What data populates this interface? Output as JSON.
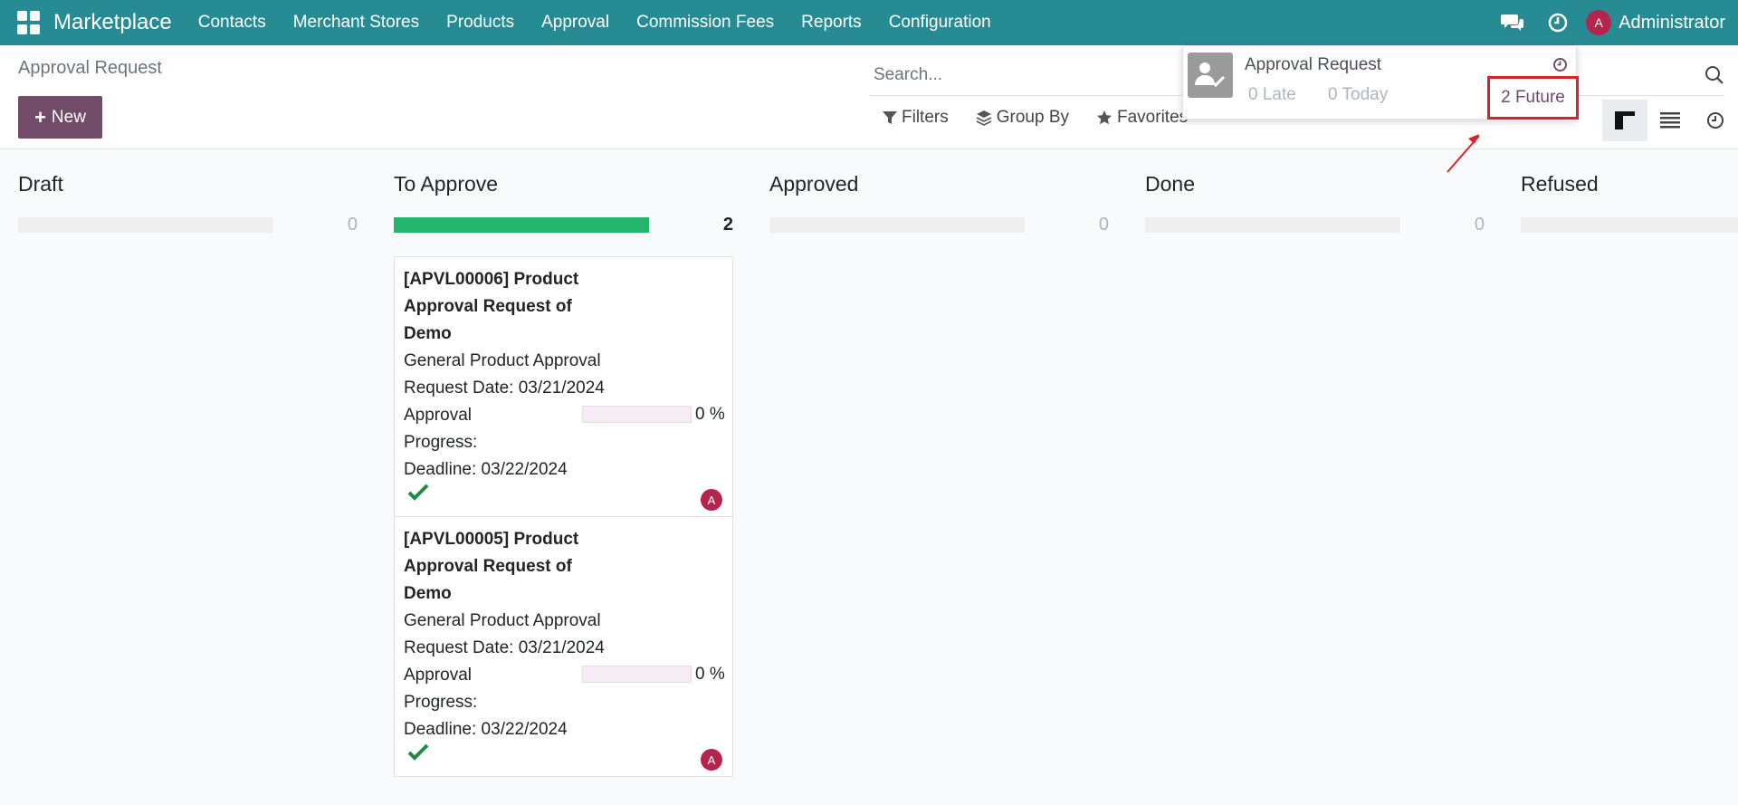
{
  "navbar": {
    "brand": "Marketplace",
    "menu": [
      "Contacts",
      "Merchant Stores",
      "Products",
      "Approval",
      "Commission Fees",
      "Reports",
      "Configuration"
    ],
    "user_initial": "A",
    "user_name": "Administrator"
  },
  "control_panel": {
    "breadcrumb": "Approval Request",
    "new_label": "New",
    "search_placeholder": "Search...",
    "filters_label": "Filters",
    "group_by_label": "Group By",
    "favorites_label": "Favorites"
  },
  "activity_popover": {
    "title": "Approval Request",
    "late": "0 Late",
    "today": "0 Today",
    "future": "2 Future"
  },
  "kanban": {
    "columns": [
      {
        "title": "Draft",
        "count": "0",
        "progress": 0
      },
      {
        "title": "To Approve",
        "count": "2",
        "progress": 1
      },
      {
        "title": "Approved",
        "count": "0",
        "progress": 0
      },
      {
        "title": "Done",
        "count": "0",
        "progress": 0
      },
      {
        "title": "Refused",
        "count": "",
        "progress": 0
      }
    ],
    "cards": [
      {
        "title": "[APVL00006] Product Approval Request of Demo",
        "title_lines": [
          "[APVL00006] Product",
          "Approval Request of",
          "Demo"
        ],
        "type": "General Product Approval",
        "request_date": "Request Date: 03/21/2024",
        "progress_label_1": "Approval",
        "progress_label_2": "Progress:",
        "progress_value": "0 %",
        "deadline": "Deadline: 03/22/2024",
        "avatar": "A"
      },
      {
        "title": "[APVL00005] Product Approval Request of Demo",
        "title_lines": [
          "[APVL00005] Product",
          "Approval Request of",
          "Demo"
        ],
        "type": "General Product Approval",
        "request_date": "Request Date: 03/21/2024",
        "progress_label_1": "Approval",
        "progress_label_2": "Progress:",
        "progress_value": "0 %",
        "deadline": "Deadline: 03/22/2024",
        "avatar": "A"
      }
    ]
  },
  "colors": {
    "navbar": "#278b93",
    "primary": "#714b67",
    "progress_full": "#22b56b",
    "highlight": "#d9222a",
    "avatar": "#b5244c",
    "check": "#1e8e3e"
  }
}
